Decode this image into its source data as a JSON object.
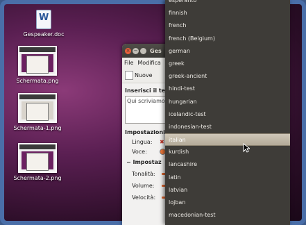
{
  "desktop": {
    "icons": [
      {
        "label": "Gespeaker.doc",
        "kind": "doc"
      },
      {
        "label": "Schermata.png",
        "kind": "screenshot"
      },
      {
        "label": "Schermata-1.png",
        "kind": "screenshot"
      },
      {
        "label": "Schermata-2.png",
        "kind": "screenshot"
      }
    ],
    "doc_glyph": "W"
  },
  "window": {
    "title": "Ges",
    "menu": {
      "file": "File",
      "edit": "Modifica",
      "more": "V"
    },
    "toolbar": {
      "new_label": "Nuove"
    },
    "text_section_title": "Inserisci il te",
    "text_value": "Qui scriviamo",
    "settings_title": "Impostazioni",
    "language_label": "Lingua:",
    "language_value": "✖",
    "voice_label": "Voce:",
    "advanced_title": "− Impostaz",
    "tone_label": "Tonalità:",
    "volume_label": "Volume:",
    "speed_label": "Velocità:"
  },
  "dropdown": {
    "items": [
      "esperanto",
      "finnish",
      "french",
      "french (Belgium)",
      "german",
      "greek",
      "greek-ancient",
      "hindi-test",
      "hungarian",
      "icelandic-test",
      "indonesian-test",
      "italian",
      "kurdish",
      "lancashire",
      "latin",
      "latvian",
      "lojban",
      "macedonian-test"
    ],
    "selected": "italian"
  }
}
